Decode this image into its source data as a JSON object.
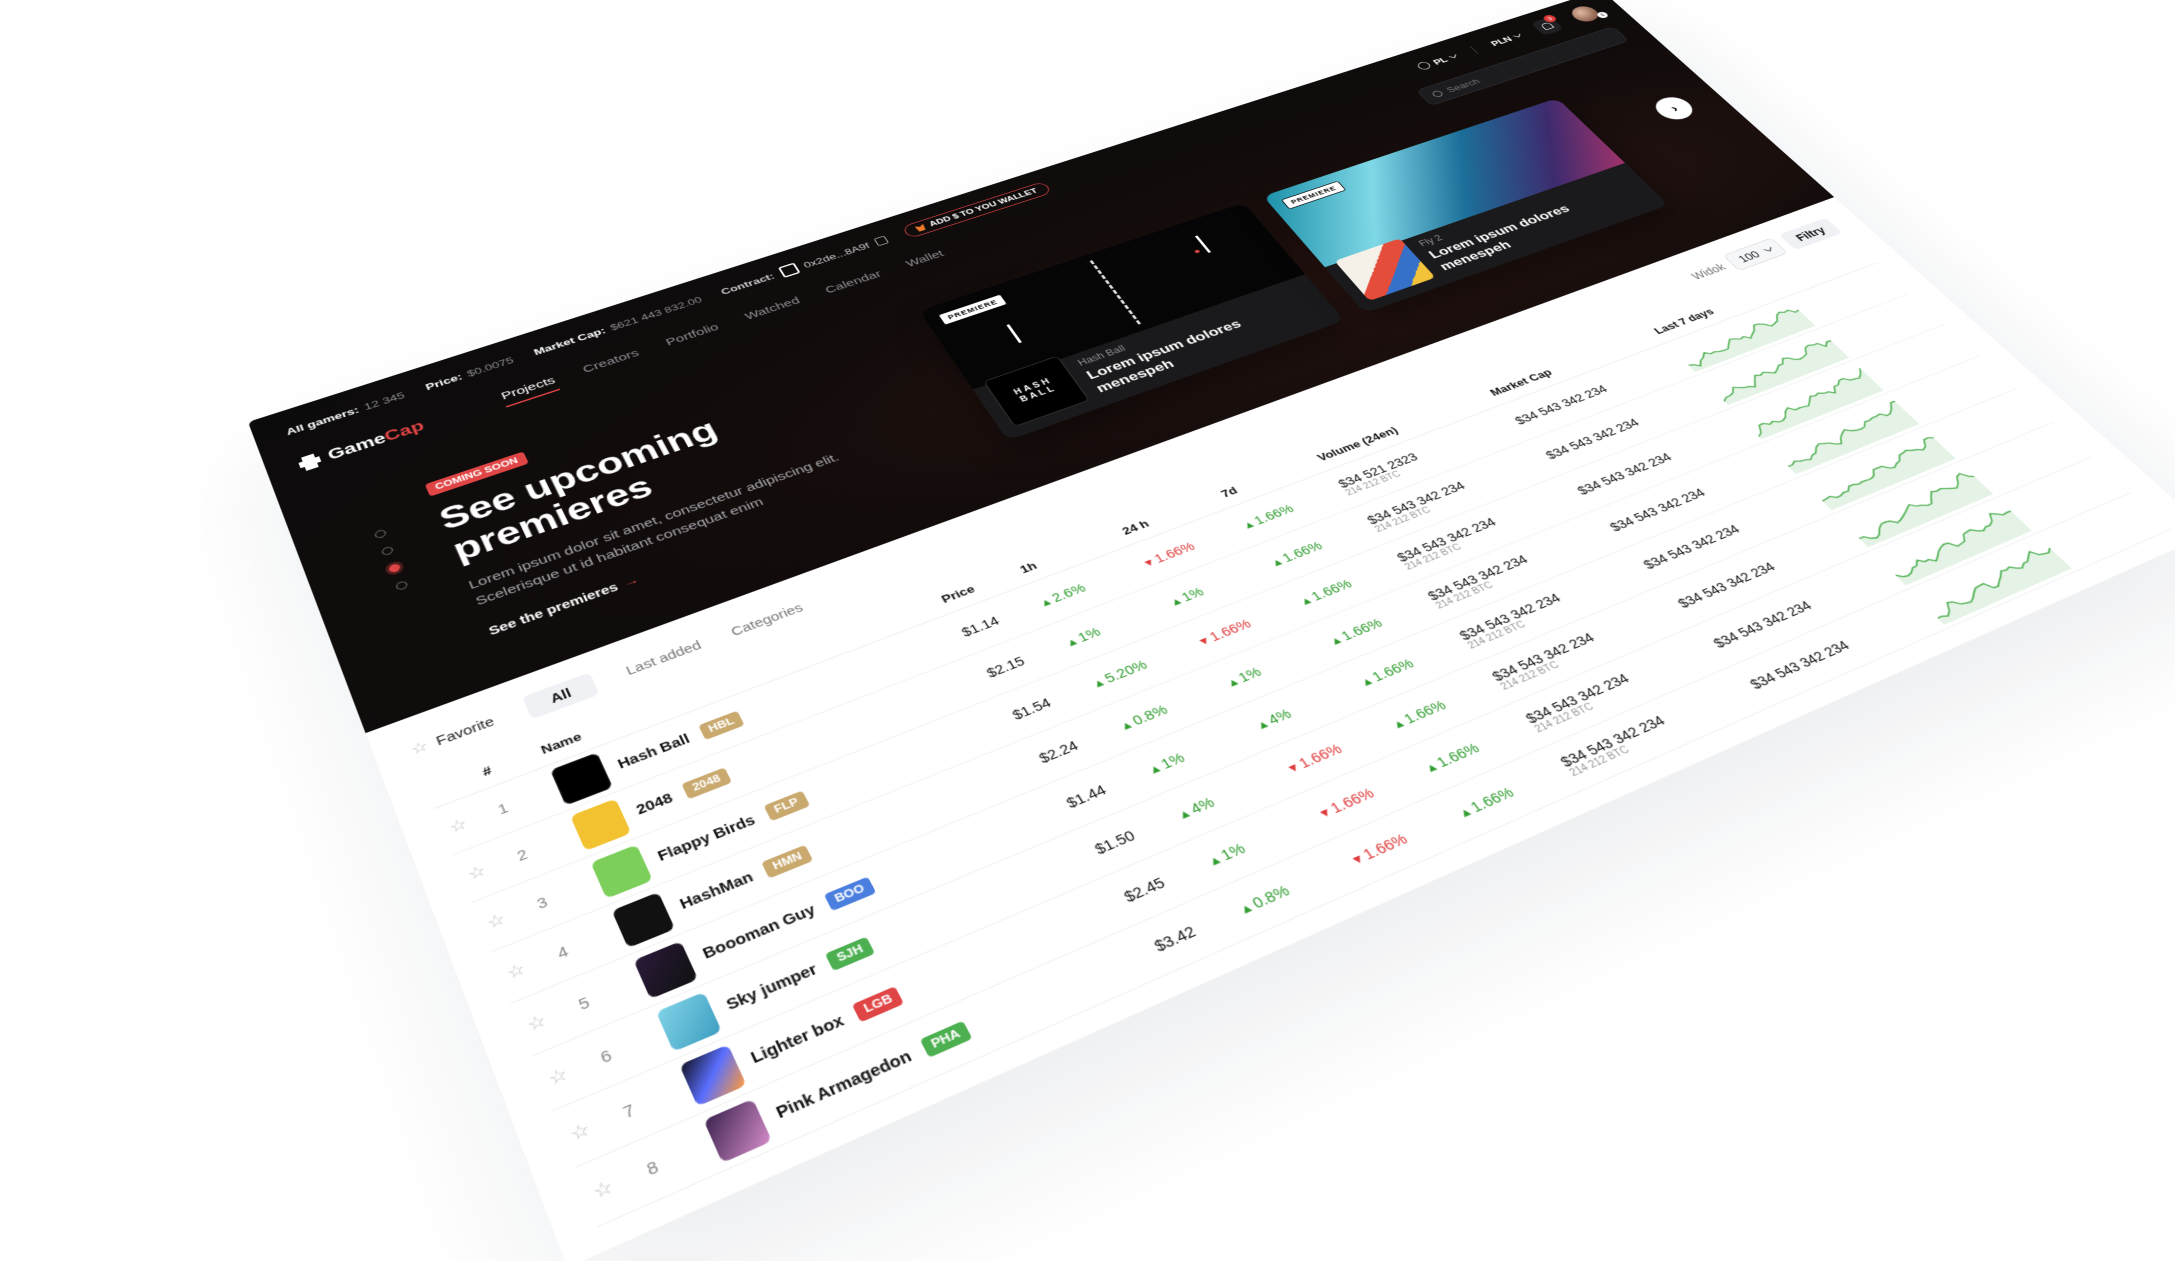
{
  "stats": {
    "all_gamers_label": "All gamers:",
    "all_gamers_value": "12 345",
    "price_label": "Price:",
    "price_value": "$0.0075",
    "market_cap_label": "Market Cap:",
    "market_cap_value": "$621 443 832.00",
    "contract_label": "Contract:",
    "contract_value": "0x2de...8A9f",
    "wallet_button": "ADD $ TO YOU WALLET"
  },
  "header": {
    "language": "PL",
    "currency": "PLN",
    "notifications": "3",
    "avatar_badge": "1"
  },
  "logo": {
    "part1": "Game",
    "part2": "Cap"
  },
  "nav": [
    "Projects",
    "Creators",
    "Portfolio",
    "Watched",
    "Calendar",
    "Wallet"
  ],
  "search": {
    "placeholder": "Search"
  },
  "hero": {
    "badge": "COMING SOON",
    "title": "See upcoming premieres",
    "desc": "Lorem ipsum dolor sit amet, consectetur adipiscing elit. Scelerisque ut id habitant consequat enim",
    "link": "See the premieres"
  },
  "cards": [
    {
      "tag": "PREMIERE",
      "sub": "Hash Ball",
      "title": "Lorem ipsum dolores menespeh",
      "thumb": "HASH BALL"
    },
    {
      "tag": "PREMIERE",
      "sub": "Fly 2",
      "title": "Lorem ipsum dolores menespeh"
    }
  ],
  "filters": {
    "favorite": "Favorite",
    "tabs": [
      "All",
      "Last added",
      "Categories"
    ],
    "widok_label": "Widok",
    "widok_value": "100",
    "filters_button": "Filtry"
  },
  "table": {
    "headers": [
      "#",
      "Name",
      "Price",
      "1h",
      "24 h",
      "7d",
      "Volume (24en)",
      "Market Cap",
      "Last 7 days"
    ],
    "rows": [
      {
        "rank": "1",
        "name": "Hash Ball",
        "ticker": "HBL",
        "price": "$1.14",
        "h1": "2.6%",
        "h24": "1.66%",
        "d7": "1.66%",
        "vol": "$34 521 2323",
        "vol_sub": "214 212 BTC",
        "cap": "$34 543 342 234"
      },
      {
        "rank": "2",
        "name": "2048",
        "ticker": "2048",
        "price": "$2.15",
        "h1": "1%",
        "h24": "1%",
        "d7": "1.66%",
        "vol": "$34 543 342 234",
        "vol_sub": "214 212 BTC",
        "cap": "$34 543 342 234"
      },
      {
        "rank": "3",
        "name": "Flappy Birds",
        "ticker": "FLP",
        "price": "$1.54",
        "h1": "5.20%",
        "h24": "1.66%",
        "d7": "1.66%",
        "vol": "$34 543 342 234",
        "vol_sub": "214 212 BTC",
        "cap": "$34 543 342 234"
      },
      {
        "rank": "4",
        "name": "HashMan",
        "ticker": "HMN",
        "price": "$2.24",
        "h1": "0.8%",
        "h24": "1%",
        "d7": "1.66%",
        "vol": "$34 543 342 234",
        "vol_sub": "214 212 BTC",
        "cap": "$34 543 342 234"
      },
      {
        "rank": "5",
        "name": "Boooman Guy",
        "ticker": "BOO",
        "price": "$1.44",
        "h1": "1%",
        "h24": "4%",
        "d7": "1.66%",
        "vol": "$34 543 342 234",
        "vol_sub": "214 212 BTC",
        "cap": "$34 543 342 234"
      },
      {
        "rank": "6",
        "name": "Sky jumper",
        "ticker": "SJH",
        "price": "$1.50",
        "h1": "4%",
        "h24": "1.66%",
        "d7": "1.66%",
        "vol": "$34 543 342 234",
        "vol_sub": "214 212 BTC",
        "cap": "$34 543 342 234"
      },
      {
        "rank": "7",
        "name": "Lighter box",
        "ticker": "LGB",
        "price": "$2.45",
        "h1": "1%",
        "h24": "1.66%",
        "d7": "1.66%",
        "vol": "$34 543 342 234",
        "vol_sub": "214 212 BTC",
        "cap": "$34 543 342 234"
      },
      {
        "rank": "8",
        "name": "Pink Armagedon",
        "ticker": "PHA",
        "price": "$3.42",
        "h1": "0.8%",
        "h24": "1.66%",
        "d7": "1.66%",
        "vol": "$34 543 342 234",
        "vol_sub": "214 212 BTC",
        "cap": "$34 543 342 234"
      }
    ]
  },
  "colors": {
    "accent": "#e04545",
    "up": "#2f9d2f",
    "down": "#e03b3b",
    "ticker_gold": "#c9a96e",
    "ticker_blue": "#4a7fe0",
    "ticker_green": "#4caf50",
    "ticker_red": "#e04545"
  }
}
